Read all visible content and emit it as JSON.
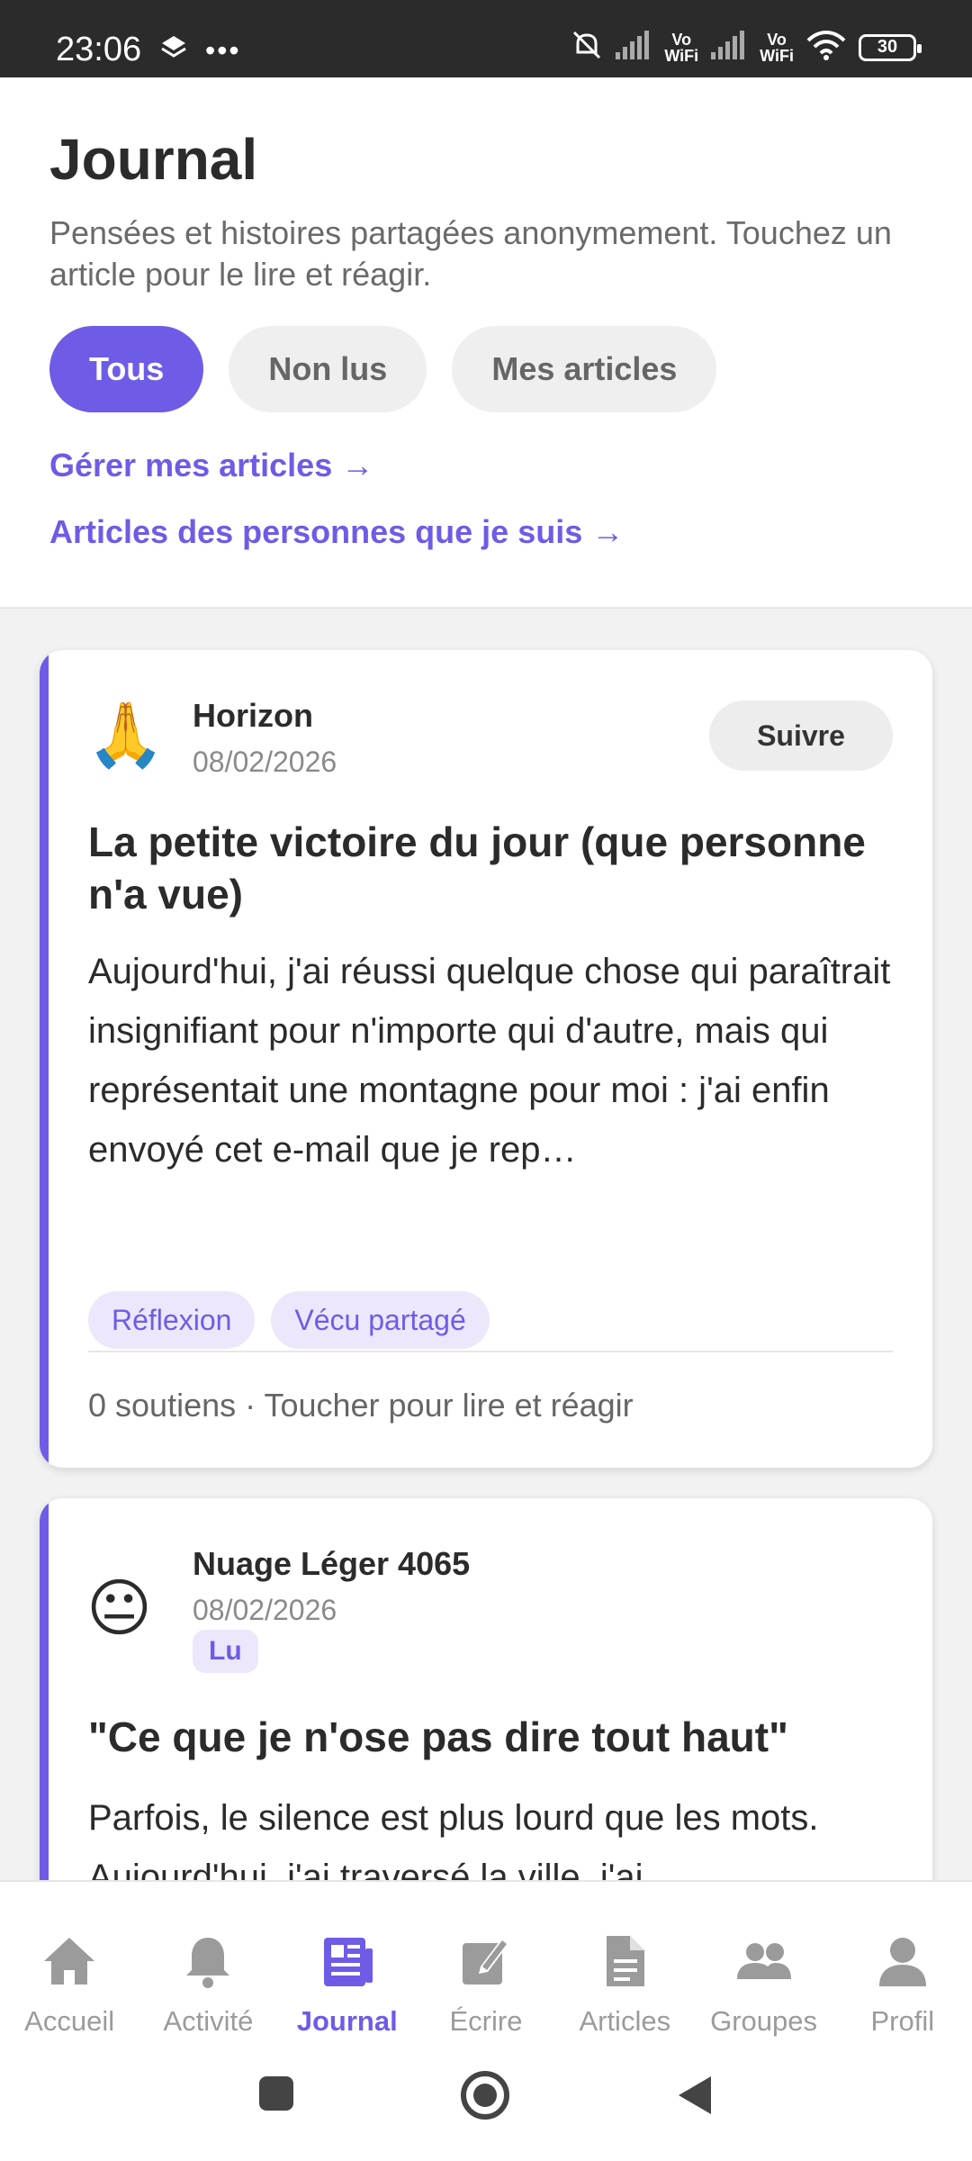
{
  "status_bar": {
    "time": "23:06",
    "battery": "30",
    "vowifi_1": "Vo\nWiFi",
    "vowifi_2": "Vo\nWiFi"
  },
  "header": {
    "title": "Journal",
    "subtitle": "Pensées et histoires partagées anonymement. Touchez un article pour le lire et réagir.",
    "filters": [
      {
        "label": "Tous",
        "active": true
      },
      {
        "label": "Non lus",
        "active": false
      },
      {
        "label": "Mes articles",
        "active": false
      }
    ],
    "link_manage": "Gérer mes articles →",
    "link_following": "Articles des personnes que je suis →"
  },
  "posts": [
    {
      "avatar_emoji": "🙏",
      "author": "Horizon",
      "date": "08/02/2026",
      "follow_label": "Suivre",
      "title": "La petite victoire du jour (que personne n'a vue)",
      "excerpt": "Aujourd'hui, j'ai réussi quelque chose qui paraîtrait insignifiant pour n'importe qui d'autre, mais qui représentait une montagne pour moi : j'ai enfin envoyé cet e-mail que je rep…",
      "tags": [
        "Réflexion",
        "Vécu partagé"
      ],
      "meta": "0 soutiens · Toucher pour lire et réagir"
    },
    {
      "avatar_emoji": "😐",
      "author": "Nuage Léger 4065",
      "date": "08/02/2026",
      "badge": "Lu",
      "title": "\"Ce que je n'ose pas dire tout haut\"",
      "excerpt": "Parfois, le silence est plus lourd que les mots. Aujourd'hui, j'ai traversé la ville, j'ai"
    }
  ],
  "bottom_nav": [
    {
      "label": "Accueil",
      "icon": "home-icon",
      "active": false
    },
    {
      "label": "Activité",
      "icon": "bell-icon",
      "active": false
    },
    {
      "label": "Journal",
      "icon": "journal-icon",
      "active": true
    },
    {
      "label": "Écrire",
      "icon": "edit-icon",
      "active": false
    },
    {
      "label": "Articles",
      "icon": "document-icon",
      "active": false
    },
    {
      "label": "Groupes",
      "icon": "group-icon",
      "active": false
    },
    {
      "label": "Profil",
      "icon": "profile-icon",
      "active": false
    }
  ],
  "colors": {
    "accent": "#6e5ce6",
    "status_bar": "#2b2b2b",
    "tag_bg": "#ece7fb"
  }
}
